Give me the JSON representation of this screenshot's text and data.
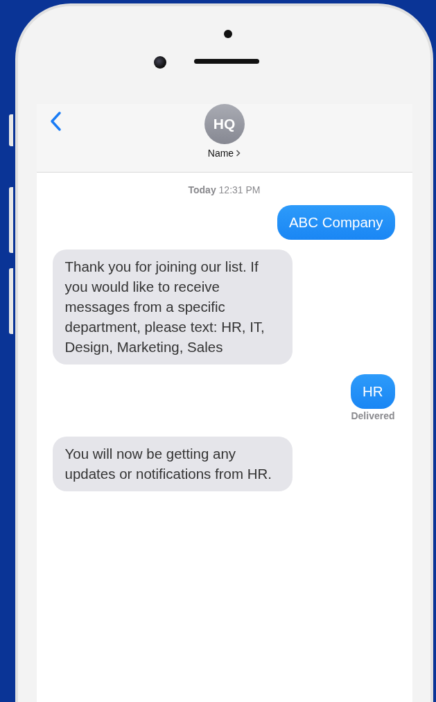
{
  "header": {
    "avatar_initials": "HQ",
    "name": "Name"
  },
  "timestamp": "**Today** 12:31 PM",
  "messages": [
    {
      "kind": "sent",
      "text": "ABC Company"
    },
    {
      "kind": "received",
      "text": "Thank you for joining our list. If you would like to receive messages from a specific department, please text: HR, IT, Design, Marketing, Sales"
    },
    {
      "kind": "sent",
      "text": "HR",
      "status": "Delivered"
    },
    {
      "kind": "received",
      "text": "You will now be getting any updates or notifications from HR."
    }
  ]
}
